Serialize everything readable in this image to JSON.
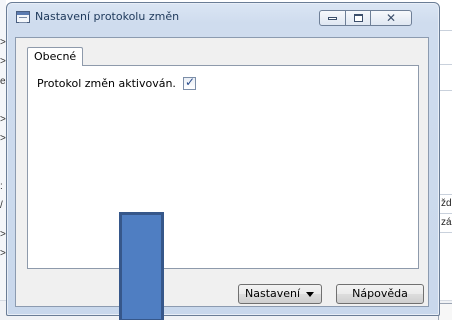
{
  "window": {
    "title": "Nastavení protokolu změn"
  },
  "tabs": [
    {
      "label": "Obecné",
      "active": true
    }
  ],
  "form": {
    "fields": [
      {
        "label": "Protokol změn aktivován.",
        "type": "checkbox",
        "checked": true,
        "mark": "✓"
      }
    ]
  },
  "buttons": {
    "settings_label": "Nastavení",
    "help_label": "Nápověda"
  },
  "background": {
    "left_markers": [
      ">",
      ">",
      "e",
      ">",
      ">",
      ":",
      "/",
      ">",
      ">"
    ],
    "right_texts": [
      "ždi",
      "zál"
    ]
  },
  "colors": {
    "title_text": "#1e395b",
    "overlay_fill": "#4f7ec2",
    "overlay_border": "#36578a",
    "checkmark": "#2b4d8c"
  }
}
